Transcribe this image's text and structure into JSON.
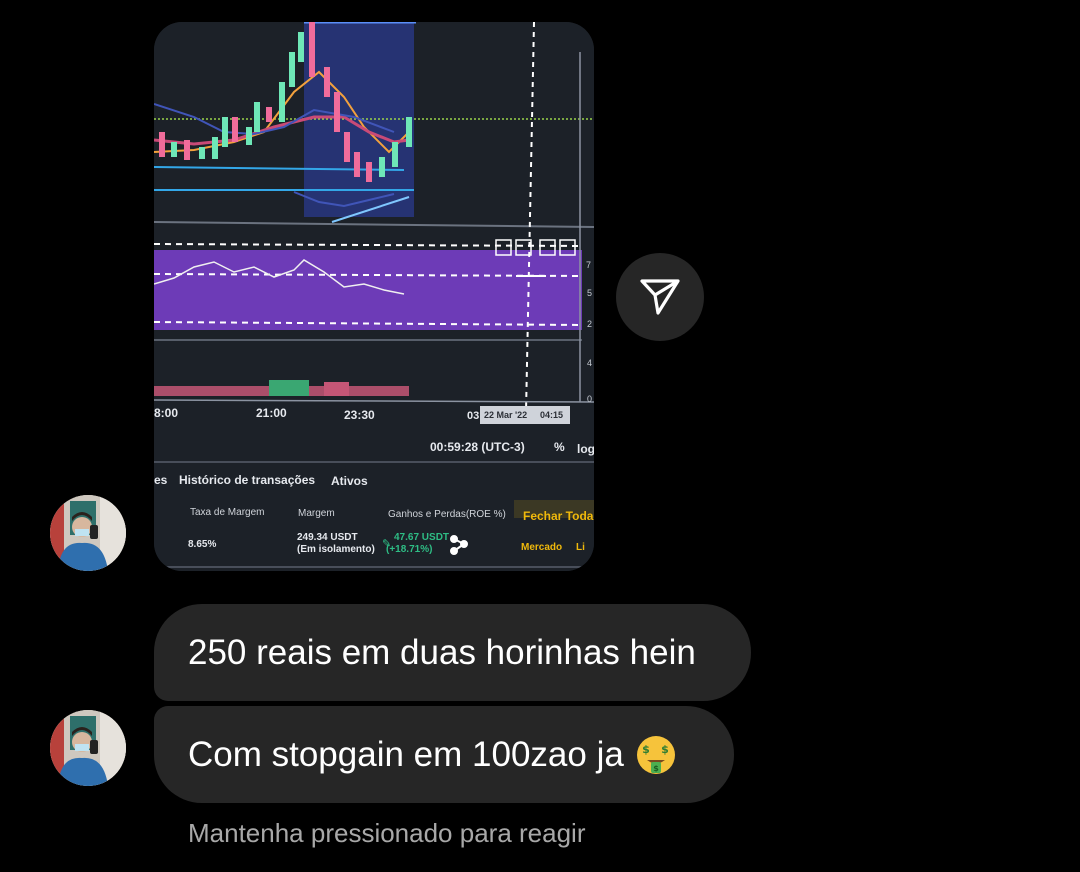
{
  "photo": {
    "time_labels": [
      "8:00",
      "21:00",
      "23:30",
      "03"
    ],
    "crosshair_date": "22 Mar '22",
    "crosshair_time": "04:15",
    "clock": "00:59:28 (UTC-3)",
    "percent_label": "%",
    "log_label": "log",
    "tabs": [
      "es",
      "Histórico de transações",
      "Ativos"
    ],
    "columns": {
      "margin_rate": "Taxa de Margem",
      "margin": "Margem",
      "pnl": "Ganhos e Perdas(ROE %)",
      "close_all": "Fechar Toda"
    },
    "row": {
      "margin_rate": "8.65%",
      "margin_value": "249.34 USDT",
      "margin_mode": "(Em isolamento)",
      "pnl_value": "47.67 USDT",
      "pnl_roe": "(+18.71%)",
      "order_type": "Mercado",
      "extra": "Li"
    },
    "axis_ticks": [
      "7",
      "5",
      "2",
      "4",
      "0"
    ]
  },
  "messages": [
    {
      "text": "250 reais em duas horinhas hein"
    },
    {
      "text": "Com stopgain em 100zao ja",
      "emoji": "money-mouth-face-icon"
    }
  ],
  "hint": "Mantenha pressionado para reagir",
  "colors": {
    "background": "#000000",
    "bubble": "#262626",
    "hint": "#a8a8a8",
    "accent_yellow": "#f0b90b",
    "positive_green": "#2ebd85"
  }
}
